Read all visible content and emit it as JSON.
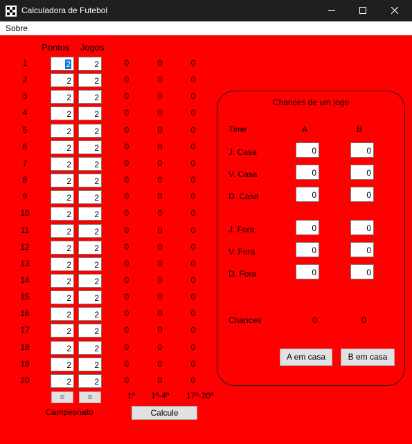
{
  "window": {
    "title": "Calculadora de Futebol",
    "minimize_glyph": "minimize",
    "maximize_glyph": "maximize",
    "close_glyph": "close"
  },
  "menu": {
    "items": [
      "Sobre"
    ]
  },
  "table": {
    "headers": {
      "points": "Pontos",
      "games": "Jogos"
    },
    "rows": [
      {
        "n": "1",
        "points": "2",
        "games": "2",
        "c1": "0",
        "c2": "0",
        "c3": "0"
      },
      {
        "n": "2",
        "points": "2",
        "games": "2",
        "c1": "0",
        "c2": "0",
        "c3": "0"
      },
      {
        "n": "3",
        "points": "2",
        "games": "2",
        "c1": "0",
        "c2": "0",
        "c3": "0"
      },
      {
        "n": "4",
        "points": "2",
        "games": "2",
        "c1": "0",
        "c2": "0",
        "c3": "0"
      },
      {
        "n": "5",
        "points": "2",
        "games": "2",
        "c1": "0",
        "c2": "0",
        "c3": "0"
      },
      {
        "n": "6",
        "points": "2",
        "games": "2",
        "c1": "0",
        "c2": "0",
        "c3": "0"
      },
      {
        "n": "7",
        "points": "2",
        "games": "2",
        "c1": "0",
        "c2": "0",
        "c3": "0"
      },
      {
        "n": "8",
        "points": "2",
        "games": "2",
        "c1": "0",
        "c2": "0",
        "c3": "0"
      },
      {
        "n": "9",
        "points": "2",
        "games": "2",
        "c1": "0",
        "c2": "0",
        "c3": "0"
      },
      {
        "n": "10",
        "points": "2",
        "games": "2",
        "c1": "0",
        "c2": "0",
        "c3": "0"
      },
      {
        "n": "11",
        "points": "2",
        "games": "2",
        "c1": "0",
        "c2": "0",
        "c3": "0"
      },
      {
        "n": "12",
        "points": "2",
        "games": "2",
        "c1": "0",
        "c2": "0",
        "c3": "0"
      },
      {
        "n": "13",
        "points": "2",
        "games": "2",
        "c1": "0",
        "c2": "0",
        "c3": "0"
      },
      {
        "n": "14",
        "points": "2",
        "games": "2",
        "c1": "0",
        "c2": "0",
        "c3": "0"
      },
      {
        "n": "15",
        "points": "2",
        "games": "2",
        "c1": "0",
        "c2": "0",
        "c3": "0"
      },
      {
        "n": "16",
        "points": "2",
        "games": "2",
        "c1": "0",
        "c2": "0",
        "c3": "0"
      },
      {
        "n": "17",
        "points": "2",
        "games": "2",
        "c1": "0",
        "c2": "0",
        "c3": "0"
      },
      {
        "n": "18",
        "points": "2",
        "games": "2",
        "c1": "0",
        "c2": "0",
        "c3": "0"
      },
      {
        "n": "19",
        "points": "2",
        "games": "2",
        "c1": "0",
        "c2": "0",
        "c3": "0"
      },
      {
        "n": "20",
        "points": "2",
        "games": "2",
        "c1": "0",
        "c2": "0",
        "c3": "0"
      }
    ],
    "equals_points": "=",
    "equals_games": "=",
    "footer": {
      "c1": "1º",
      "c2": "1º-4º",
      "c3": "17º-20º",
      "championship": "Campeonato",
      "calculate": "Calcule"
    }
  },
  "match": {
    "title": "Chances de um jogo",
    "team_label": "Time",
    "team_a": "A",
    "team_b": "B",
    "rows": [
      {
        "label": "J. Casa",
        "a": "0",
        "b": "0"
      },
      {
        "label": "V. Casa",
        "a": "0",
        "b": "0"
      },
      {
        "label": "D. Casa",
        "a": "0",
        "b": "0"
      },
      {
        "label": "J. Fora",
        "a": "0",
        "b": "0"
      },
      {
        "label": "V. Fora",
        "a": "0",
        "b": "0"
      },
      {
        "label": "D. Fora",
        "a": "0",
        "b": "0"
      }
    ],
    "chances_label": "Chances",
    "chance_a": "0",
    "chance_b": "0",
    "btn_a_home": "A em casa",
    "btn_b_home": "B em casa"
  },
  "colors": {
    "background": "#ff0000",
    "titlebar": "#1f1f1f",
    "selection": "#0078d7"
  }
}
